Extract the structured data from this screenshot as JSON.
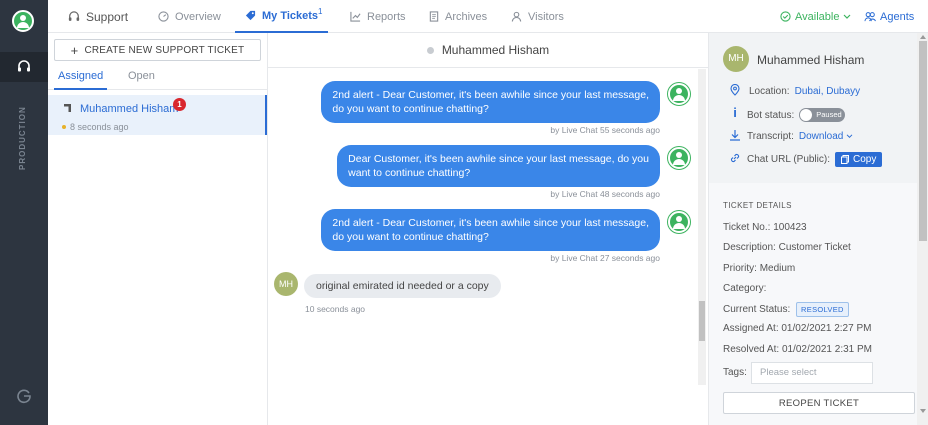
{
  "rail": {
    "section_label": "PRODUCTION"
  },
  "nav": {
    "support": "Support",
    "overview": "Overview",
    "my_tickets": "My Tickets",
    "my_tickets_count": "1",
    "reports": "Reports",
    "archives": "Archives",
    "visitors": "Visitors",
    "status": "Available",
    "agents": "Agents"
  },
  "list": {
    "create_button": "CREATE NEW SUPPORT TICKET",
    "tabs": [
      "Assigned",
      "Open"
    ],
    "tickets": [
      {
        "name": "Muhammed Hisham",
        "badge": "1",
        "time": "8 seconds ago"
      }
    ]
  },
  "chat": {
    "header_name": "Muhammed Hisham",
    "messages": [
      {
        "text_1": "2nd alert - Dear Customer, it's been awhile since your last message,",
        "text_2": "do you want to continue chatting?",
        "meta": "by Live Chat  55 seconds ago"
      },
      {
        "text_1": "Dear Customer, it's been awhile since your last message, do you",
        "text_2": "want to continue chatting?",
        "meta": "by Live Chat  48 seconds ago"
      },
      {
        "text_1": "2nd alert - Dear Customer, it's been awhile since your last message,",
        "text_2": "do you want to continue chatting?",
        "meta": "by Live Chat  27 seconds ago"
      }
    ],
    "incoming": {
      "initials": "MH",
      "text": "original emirated id needed or a copy",
      "time": "10 seconds ago"
    }
  },
  "details": {
    "initials": "MH",
    "name": "Muhammed Hisham",
    "location_label": "Location:",
    "location_value": "Dubai, Dubayy",
    "bot_status_label": "Bot status:",
    "bot_status_value": "Paused",
    "transcript_label": "Transcript:",
    "transcript_value": "Download",
    "chat_url_label": "Chat URL (Public):",
    "copy_label": "Copy",
    "section_title": "TICKET DETAILS",
    "ticket_no_label": "Ticket No.:",
    "ticket_no": "100423",
    "description_label": "Description:",
    "description": "Customer Ticket",
    "priority_label": "Priority:",
    "priority": "Medium",
    "category_label": "Category:",
    "category": "",
    "status_label": "Current Status:",
    "status": "RESOLVED",
    "assigned_label": "Assigned At:",
    "assigned_at": "01/02/2021 2:27 PM",
    "resolved_label": "Resolved At:",
    "resolved_at": "01/02/2021 2:31 PM",
    "tags_label": "Tags:",
    "tags_placeholder": "Please select",
    "reopen_button": "REOPEN TICKET"
  }
}
